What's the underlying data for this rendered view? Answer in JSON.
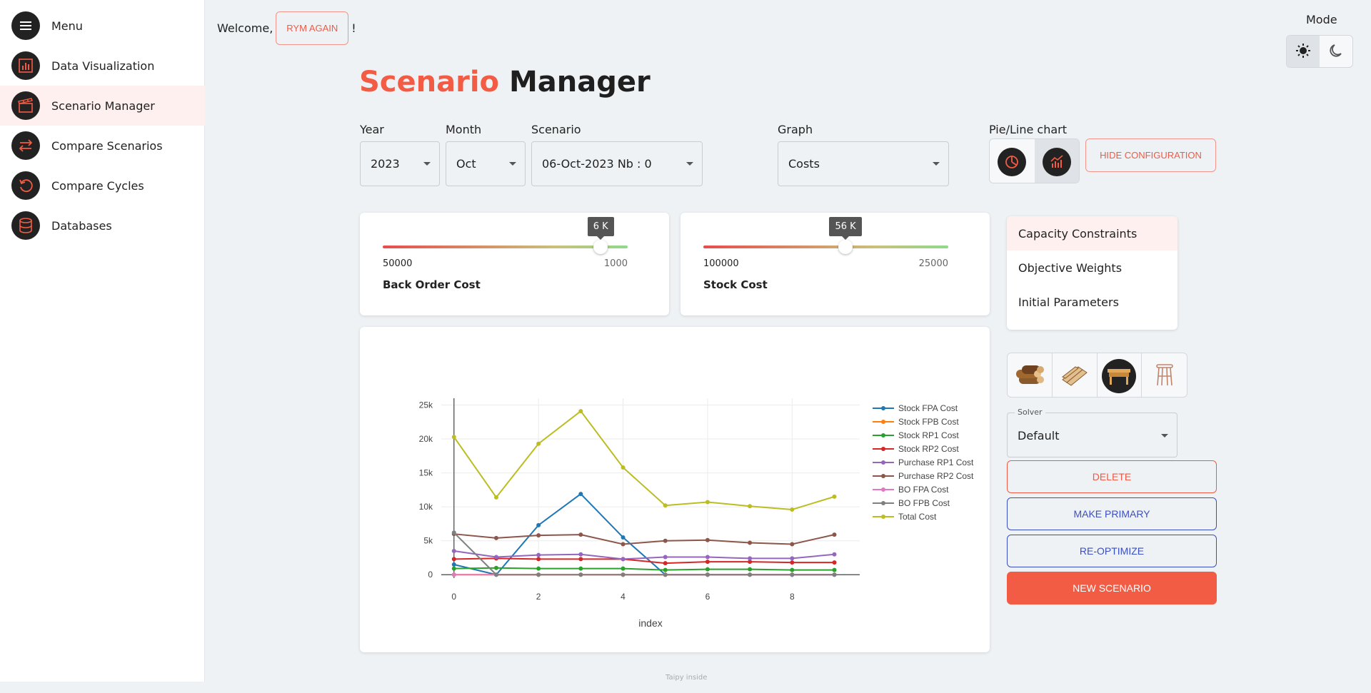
{
  "sidebar": {
    "items": [
      {
        "label": "Menu",
        "icon": "hamburger-icon"
      },
      {
        "label": "Data Visualization",
        "icon": "bar-chart-icon"
      },
      {
        "label": "Scenario Manager",
        "icon": "clapperboard-icon"
      },
      {
        "label": "Compare Scenarios",
        "icon": "swap-arrows-icon"
      },
      {
        "label": "Compare Cycles",
        "icon": "cycle-icon"
      },
      {
        "label": "Databases",
        "icon": "database-icon"
      }
    ],
    "active_index": 2
  },
  "header": {
    "welcome": "Welcome,",
    "user": "RYM AGAIN",
    "bang": "!",
    "mode_label": "Mode"
  },
  "title": {
    "accent": "Scenario",
    "rest": "Manager"
  },
  "filters": {
    "year": {
      "label": "Year",
      "value": "2023"
    },
    "month": {
      "label": "Month",
      "value": "Oct"
    },
    "scenario": {
      "label": "Scenario",
      "value": "06-Oct-2023 Nb : 0"
    },
    "graph": {
      "label": "Graph",
      "value": "Costs"
    },
    "chart_toggle_label": "Pie/Line chart",
    "hide_config": "HIDE CONFIGURATION"
  },
  "sliders": [
    {
      "tip": "6 K",
      "min": "50000",
      "max": "1000",
      "name": "Back Order Cost",
      "level": 0.89
    },
    {
      "tip": "56 K",
      "min": "100000",
      "max": "25000",
      "name": "Stock Cost",
      "level": 0.58
    }
  ],
  "config_menu": [
    "Capacity Constraints",
    "Objective Weights",
    "Initial Parameters"
  ],
  "solver": {
    "legend": "Solver",
    "value": "Default"
  },
  "actions": {
    "delete": "DELETE",
    "primary": "MAKE PRIMARY",
    "reoptimize": "RE-OPTIMIZE",
    "new": "NEW SCENARIO"
  },
  "footer": "Taipy inside",
  "colors": {
    "accent": "#f25c45",
    "primary": "#3c4fc0"
  },
  "chart_data": {
    "type": "line",
    "xlabel": "index",
    "ylabel": "",
    "x": [
      0,
      1,
      2,
      3,
      4,
      5,
      6,
      7,
      8,
      9
    ],
    "xticks": [
      0,
      2,
      4,
      6,
      8
    ],
    "yticks": [
      0,
      5000,
      10000,
      15000,
      20000,
      25000
    ],
    "ytick_labels": [
      "0",
      "5k",
      "10k",
      "15k",
      "20k",
      "25k"
    ],
    "ylim": [
      -500,
      26000
    ],
    "xlim": [
      -0.3,
      9.6
    ],
    "legend_position": "right",
    "series": [
      {
        "name": "Stock FPA Cost",
        "color": "#1f77b4",
        "values": [
          1500,
          0,
          7300,
          11900,
          5500,
          0,
          0,
          0,
          0,
          0
        ]
      },
      {
        "name": "Stock FPB Cost",
        "color": "#ff7f0e",
        "values": [
          0,
          0,
          0,
          0,
          0,
          0,
          0,
          0,
          0,
          0
        ]
      },
      {
        "name": "Stock RP1 Cost",
        "color": "#2ca02c",
        "values": [
          900,
          1000,
          900,
          900,
          900,
          700,
          800,
          800,
          700,
          700
        ]
      },
      {
        "name": "Stock RP2 Cost",
        "color": "#d62728",
        "values": [
          2300,
          2400,
          2300,
          2300,
          2300,
          1700,
          1900,
          1900,
          1800,
          1800
        ]
      },
      {
        "name": "Purchase RP1 Cost",
        "color": "#9467bd",
        "values": [
          3500,
          2600,
          2900,
          3000,
          2300,
          2600,
          2600,
          2400,
          2400,
          3000
        ]
      },
      {
        "name": "Purchase RP2 Cost",
        "color": "#8c564b",
        "values": [
          6000,
          5400,
          5800,
          5900,
          4500,
          5000,
          5100,
          4700,
          4500,
          5900
        ]
      },
      {
        "name": "BO FPA Cost",
        "color": "#e377c2",
        "values": [
          0,
          0,
          0,
          0,
          0,
          0,
          0,
          0,
          0,
          0
        ]
      },
      {
        "name": "BO FPB Cost",
        "color": "#7f7f7f",
        "values": [
          6200,
          0,
          0,
          0,
          0,
          0,
          0,
          0,
          0,
          0
        ]
      },
      {
        "name": "Total Cost",
        "color": "#bcbd22",
        "values": [
          20300,
          11400,
          19300,
          24100,
          15800,
          10200,
          10700,
          10100,
          9600,
          11500
        ]
      }
    ]
  }
}
